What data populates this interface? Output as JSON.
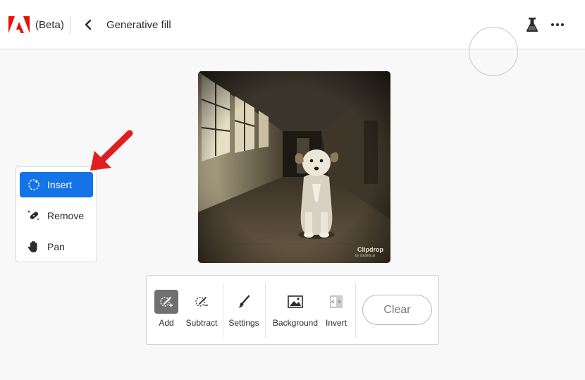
{
  "header": {
    "beta_label": "(Beta)",
    "title": "Generative fill"
  },
  "tools": [
    {
      "label": "Insert",
      "icon": "insert-selection-icon",
      "active": true
    },
    {
      "label": "Remove",
      "icon": "magic-wand-bandage-icon",
      "active": false
    },
    {
      "label": "Pan",
      "icon": "hand-icon",
      "active": false
    }
  ],
  "canvas": {
    "watermark": "Clipdrop",
    "watermark_sub": "by stability.ai"
  },
  "bottombar": {
    "add_label": "Add",
    "subtract_label": "Subtract",
    "settings_label": "Settings",
    "background_label": "Background",
    "invert_label": "Invert",
    "clear_label": "Clear"
  },
  "colors": {
    "accent": "#1473e6",
    "brand_red": "#eb1000",
    "annotation_arrow": "#e02020"
  }
}
